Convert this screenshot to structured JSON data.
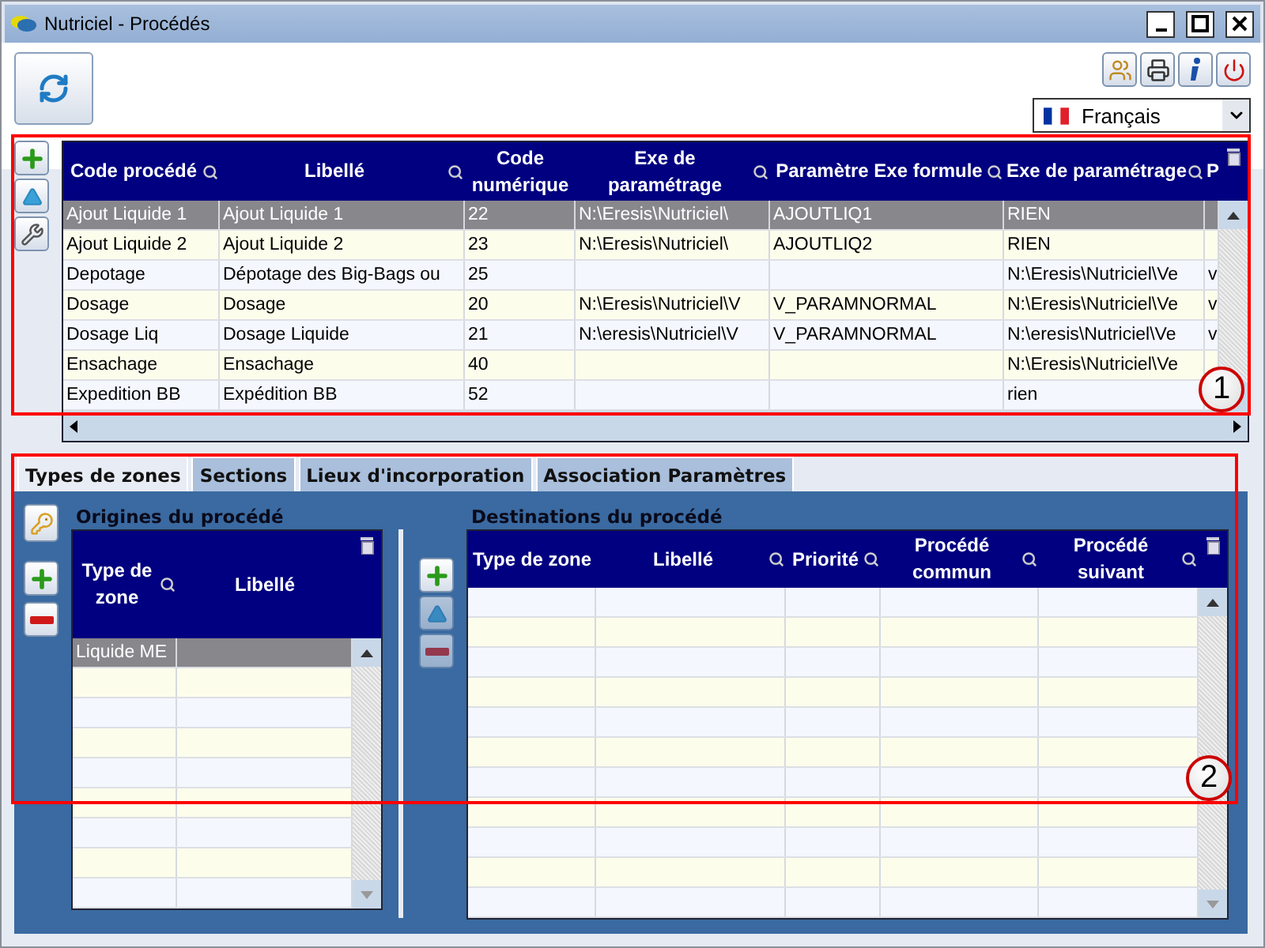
{
  "window": {
    "title": "Nutriciel - Procédés"
  },
  "language": {
    "value": "Français"
  },
  "main_table": {
    "columns": [
      {
        "label": "Code procédé",
        "search": true
      },
      {
        "label": "Libellé",
        "search": true
      },
      {
        "label": "Code numérique",
        "search": false
      },
      {
        "label": "Exe de paramétrage",
        "search": true
      },
      {
        "label": "Paramètre Exe formule",
        "search": true
      },
      {
        "label": "Exe de paramétrage",
        "search": true
      },
      {
        "label": "P",
        "search": false
      }
    ],
    "rows": [
      {
        "selected": true,
        "cells": [
          "Ajout Liquide 1",
          "Ajout Liquide 1",
          "22",
          "N:\\Eresis\\Nutriciel\\",
          "AJOUTLIQ1",
          "RIEN",
          ""
        ]
      },
      {
        "selected": false,
        "cells": [
          "Ajout Liquide 2",
          "Ajout Liquide 2",
          "23",
          "N:\\Eresis\\Nutriciel\\",
          "AJOUTLIQ2",
          "RIEN",
          ""
        ]
      },
      {
        "selected": false,
        "cells": [
          "Depotage",
          "Dépotage des Big-Bags ou",
          "25",
          "",
          "",
          "N:\\Eresis\\Nutriciel\\Ve",
          "v"
        ]
      },
      {
        "selected": false,
        "cells": [
          "Dosage",
          "Dosage",
          "20",
          "N:\\Eresis\\Nutriciel\\V",
          "V_PARAMNORMAL",
          "N:\\Eresis\\Nutriciel\\Ve",
          "v"
        ]
      },
      {
        "selected": false,
        "cells": [
          "Dosage Liq",
          "Dosage Liquide",
          "21",
          "N:\\eresis\\Nutriciel\\V",
          "V_PARAMNORMAL",
          "N:\\eresis\\Nutriciel\\Ve",
          "v"
        ]
      },
      {
        "selected": false,
        "cells": [
          "Ensachage",
          "Ensachage",
          "40",
          "",
          "",
          "N:\\Eresis\\Nutriciel\\Ve",
          ""
        ]
      },
      {
        "selected": false,
        "cells": [
          "Expedition BB",
          "Expédition BB",
          "52",
          "",
          "",
          "rien",
          ""
        ]
      }
    ]
  },
  "tabs": [
    {
      "label": "Types de zones",
      "selected": true
    },
    {
      "label": "Sections",
      "selected": false
    },
    {
      "label": "Lieux d'incorporation",
      "selected": false
    },
    {
      "label": "Association Paramètres",
      "selected": false
    }
  ],
  "origins": {
    "title": "Origines du procédé",
    "columns": [
      {
        "label": "Type de zone",
        "search": true
      },
      {
        "label": "Libellé",
        "search": false
      }
    ],
    "rows": [
      {
        "selected": true,
        "cells": [
          "Liquide ME",
          ""
        ]
      }
    ]
  },
  "destinations": {
    "title": "Destinations du procédé",
    "columns": [
      {
        "label": "Type de zone",
        "search": false
      },
      {
        "label": "Libellé",
        "search": true
      },
      {
        "label": "Priorité",
        "search": true
      },
      {
        "label": "Procédé commun",
        "search": true
      },
      {
        "label": "Procédé suivant",
        "search": true
      }
    ]
  },
  "callouts": [
    {
      "label": "1"
    },
    {
      "label": "2"
    }
  ]
}
